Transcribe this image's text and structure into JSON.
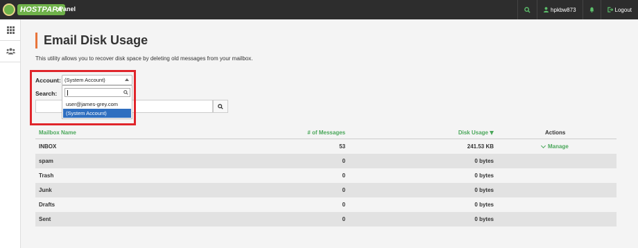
{
  "topbar": {
    "logo_text": "HOSTPAPA",
    "brand": "cPanel",
    "username": "hpkbw873",
    "logout_label": "Logout"
  },
  "page": {
    "title": "Email Disk Usage",
    "description": "This utility allows you to recover disk space by deleting old messages from your mailbox."
  },
  "form": {
    "account_label": "Account:",
    "search_label": "Search:",
    "selected_account": "(System Account)",
    "dropdown_search_value": "",
    "options": [
      "user@james-grey.com",
      "(System Account)"
    ]
  },
  "table": {
    "headers": {
      "name": "Mailbox Name",
      "messages": "# of Messages",
      "disk": "Disk Usage",
      "actions": "Actions"
    },
    "rows": [
      {
        "name": "INBOX",
        "messages": "53",
        "disk": "241.53 KB",
        "action": "Manage"
      },
      {
        "name": "spam",
        "messages": "0",
        "disk": "0 bytes",
        "action": ""
      },
      {
        "name": "Trash",
        "messages": "0",
        "disk": "0 bytes",
        "action": ""
      },
      {
        "name": "Junk",
        "messages": "0",
        "disk": "0 bytes",
        "action": ""
      },
      {
        "name": "Drafts",
        "messages": "0",
        "disk": "0 bytes",
        "action": ""
      },
      {
        "name": "Sent",
        "messages": "0",
        "disk": "0 bytes",
        "action": ""
      }
    ]
  },
  "colors": {
    "accent_green": "#4aa75a",
    "title_bar": "#e8743b",
    "highlight_red": "#e0252b",
    "selected_blue": "#2f6fc0"
  },
  "icons": {
    "sidebar": [
      "grid-icon",
      "users-icon"
    ],
    "topbar": [
      "search-icon",
      "user-icon",
      "bell-icon",
      "logout-icon"
    ]
  }
}
